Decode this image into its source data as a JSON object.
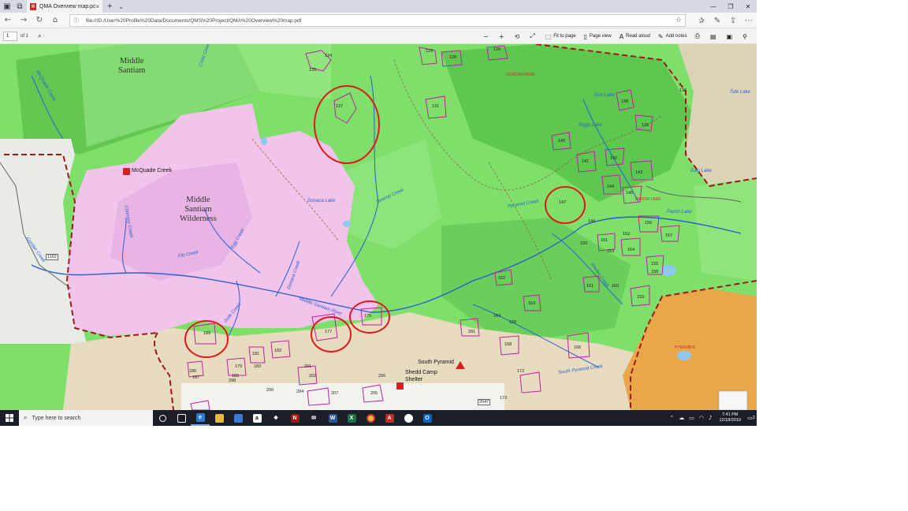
{
  "browser": {
    "tab_title": "QMA Overview map.pd",
    "tab_close": "×",
    "new_tab": "+",
    "tab_list": "⌄",
    "url": "file:///D:/User%20Profile%20Data/Documents/QMS%20Project/QMA%20Overview%20map.pdf",
    "window_minimize": "—",
    "window_maximize": "❐",
    "window_close": "✕"
  },
  "pdf_toolbar": {
    "page_number": "1",
    "page_of": "of 1",
    "fit_to_page": "Fit to page",
    "page_view": "Page view",
    "read_aloud": "Read aloud",
    "add_notes": "Add notes"
  },
  "map": {
    "region_labels": {
      "middle_santiam_north": "Middle\nSantiam",
      "wilderness": "Middle\nSantiam\nWilderness"
    },
    "poi_labels": {
      "mcquade_creek": "McQuade Creek",
      "south_pyramid": "South Pyramid",
      "shedd_camp": "Shedd Camp\nShelter"
    },
    "water_labels": [
      "Don Lake",
      "Riggs Lake",
      "Daly Lake",
      "Parish Lake",
      "Donaca Lake",
      "Tule Lake",
      "Fitt Creek",
      "Egg Creek",
      "Middle Santiam River",
      "Pyramid Creek",
      "Swamp Creek",
      "South Pyramid Creek",
      "Shelter Creek",
      "Chimney Creek",
      "Donaca Creek",
      "Jude Creek",
      "McQuade Creek",
      "Gordan Creek",
      "Crete Creek"
    ],
    "peak_labels": [
      "GORDAN PEAK",
      "PARISH LAKE",
      "PYRAMIDS"
    ],
    "unit_numbers": [
      "134",
      "135",
      "137",
      "129",
      "128",
      "126",
      "131",
      "136",
      "138",
      "139",
      "140",
      "141",
      "142",
      "143",
      "144",
      "145",
      "147",
      "149",
      "150",
      "151",
      "152",
      "153",
      "154",
      "155",
      "156",
      "157",
      "158",
      "159",
      "160",
      "161",
      "162",
      "163",
      "164",
      "165",
      "166",
      "168",
      "172",
      "173",
      "176",
      "177",
      "179",
      "181",
      "182",
      "183",
      "185",
      "186",
      "187",
      "189",
      "200",
      "201",
      "202",
      "204",
      "205",
      "206",
      "207",
      "291",
      "298"
    ],
    "road_numbers": [
      "1162",
      "2047"
    ],
    "circled_units": [
      "137",
      "147",
      "176",
      "177",
      "189"
    ]
  },
  "taskbar": {
    "search_placeholder": "Type here to search",
    "time": "7:41 PM",
    "date": "12/18/2019",
    "notification_count": "2"
  },
  "colors": {
    "forest_green": "#7ee06a",
    "wilderness_pink": "#f2c4ec",
    "private_tan": "#e8dcc0",
    "pyramids_orange": "#e8a84a",
    "unit_outline": "#c020a0",
    "circle": "#e01818",
    "water": "#2a5fd0"
  }
}
